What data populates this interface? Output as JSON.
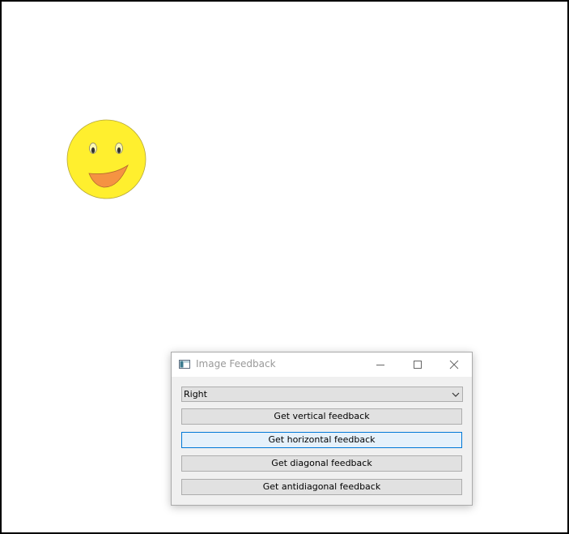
{
  "canvas": {
    "image": "smiley-face"
  },
  "window": {
    "title": "Image Feedback",
    "icon": "app-window-icon",
    "controls": [
      "minimize-icon",
      "maximize-icon",
      "close-icon"
    ]
  },
  "direction_select": {
    "value": "Right",
    "icon": "chevron-down-icon"
  },
  "buttons": {
    "vertical": "Get vertical feedback",
    "horizontal": "Get horizontal feedback",
    "diagonal": "Get diagonal feedback",
    "antidiagonal": "Get antidiagonal feedback"
  },
  "colors": {
    "face": "#ffef2e",
    "mouth": "#f59342",
    "focus_accent": "#0078d7"
  }
}
